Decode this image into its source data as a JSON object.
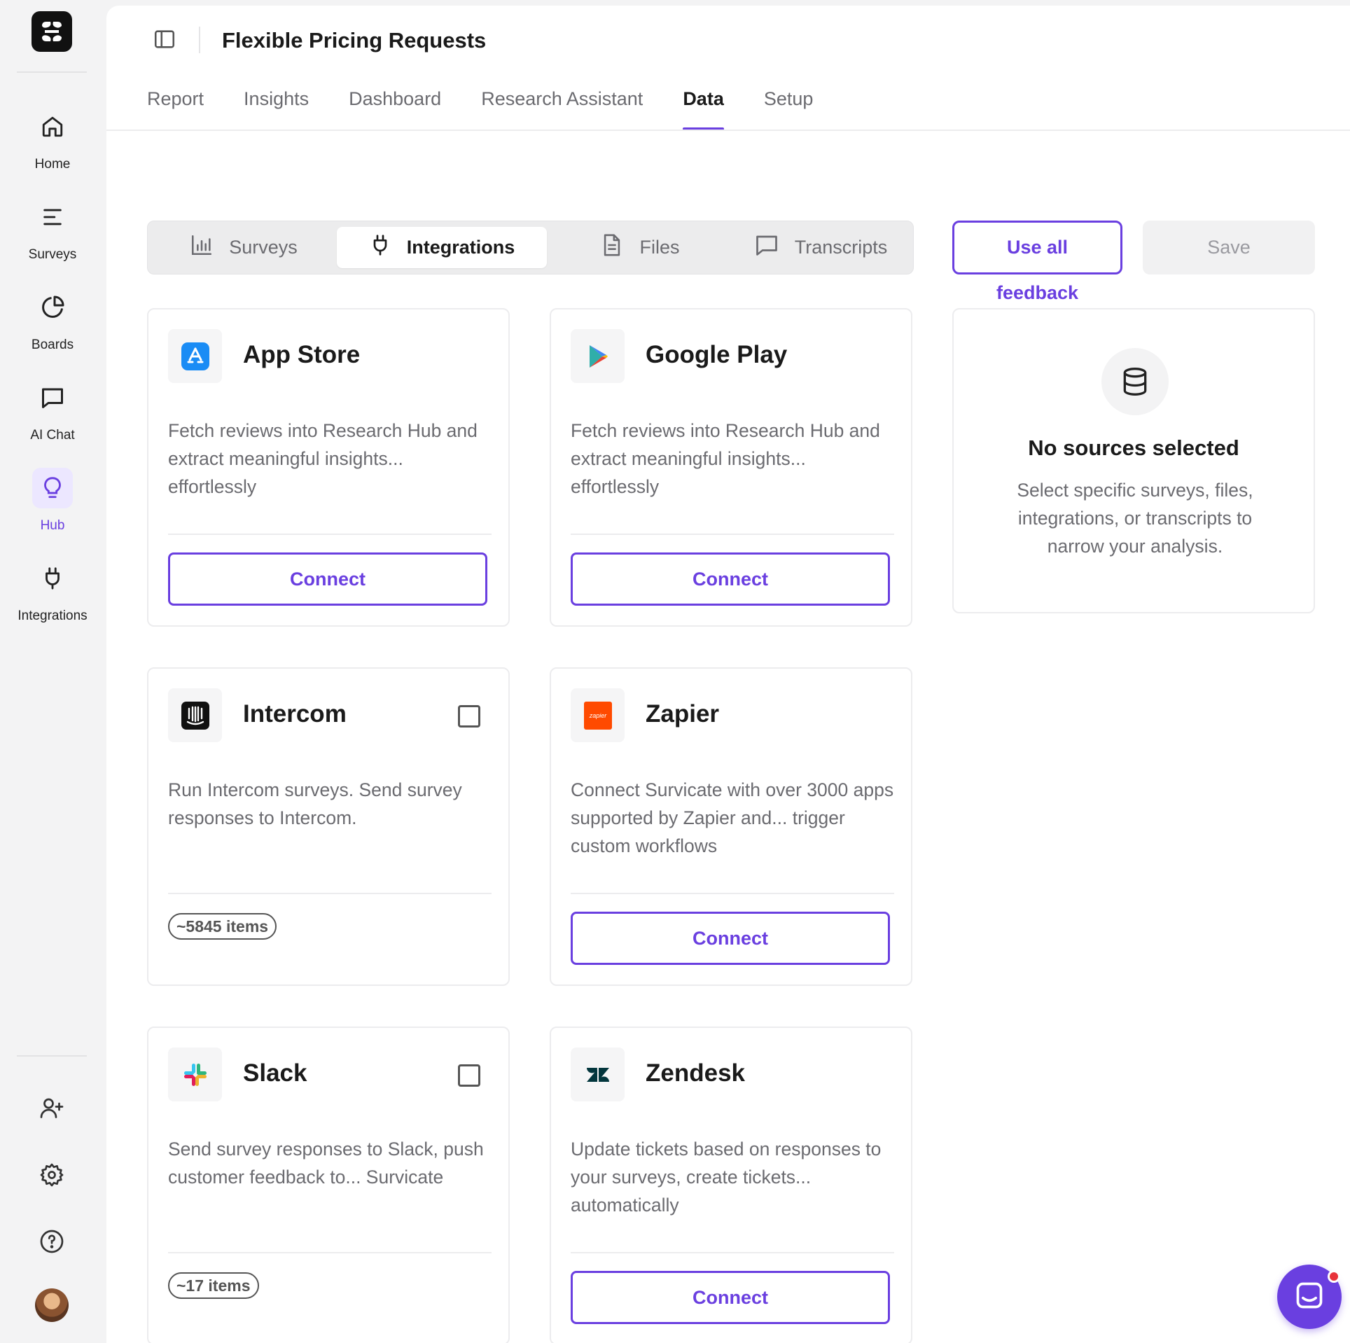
{
  "sidebar": {
    "items": [
      {
        "label": "Home",
        "icon": "home-icon"
      },
      {
        "label": "Surveys",
        "icon": "list-icon"
      },
      {
        "label": "Boards",
        "icon": "pie-chart-icon"
      },
      {
        "label": "AI Chat",
        "icon": "chat-bubble-icon"
      },
      {
        "label": "Hub",
        "icon": "lightbulb-icon",
        "active": true
      },
      {
        "label": "Integrations",
        "icon": "plug-icon"
      }
    ],
    "bottom_icons": [
      "add-user-icon",
      "gear-icon",
      "help-icon"
    ]
  },
  "header": {
    "title": "Flexible Pricing Requests"
  },
  "tabs": [
    {
      "label": "Report"
    },
    {
      "label": "Insights"
    },
    {
      "label": "Dashboard"
    },
    {
      "label": "Research Assistant"
    },
    {
      "label": "Data",
      "active": true
    },
    {
      "label": "Setup"
    }
  ],
  "segments": [
    {
      "label": "Surveys",
      "icon": "bar-chart-icon"
    },
    {
      "label": "Integrations",
      "icon": "plug-icon",
      "active": true
    },
    {
      "label": "Files",
      "icon": "file-icon"
    },
    {
      "label": "Transcripts",
      "icon": "chat-bubble-icon"
    }
  ],
  "actions": {
    "use_all": "Use all",
    "feedback": "feedback",
    "save": "Save"
  },
  "cards": [
    {
      "title": "App Store",
      "description": "Fetch reviews into Research Hub and extract meaningful insights... effortlessly",
      "button": "Connect"
    },
    {
      "title": "Google Play",
      "description": "Fetch reviews into Research Hub and extract meaningful insights... effortlessly",
      "button": "Connect"
    },
    {
      "title": "Intercom",
      "description": "Run Intercom surveys. Send survey responses to Intercom.",
      "count": "~5845 items"
    },
    {
      "title": "Zapier",
      "description": "Connect Survicate with over 3000 apps supported by Zapier and... trigger custom workflows",
      "button": "Connect",
      "logo_text": "zapier"
    },
    {
      "title": "Slack",
      "description": "Send survey responses to Slack, push customer feedback to... Survicate",
      "count": "~17 items"
    },
    {
      "title": "Zendesk",
      "description": "Update tickets based on responses to your surveys, create tickets... automatically",
      "button": "Connect"
    }
  ],
  "no_sources": {
    "title": "No sources selected",
    "description": "Select specific surveys, files, integrations, or transcripts to narrow your analysis."
  },
  "colors": {
    "accent": "#6a3fe0",
    "accent_light": "#ece7ff",
    "notification": "#e8333a"
  }
}
